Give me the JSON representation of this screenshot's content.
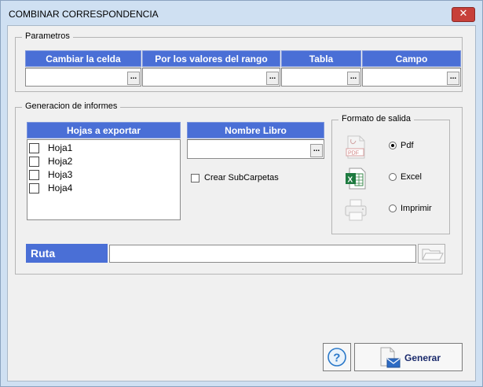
{
  "window": {
    "title": "COMBINAR CORRESPONDENCIA",
    "close_glyph": "✕"
  },
  "parametros": {
    "legend": "Parametros",
    "columns": [
      {
        "header": "Cambiar la celda",
        "value": ""
      },
      {
        "header": "Por los valores del rango",
        "value": ""
      },
      {
        "header": "Tabla",
        "value": ""
      },
      {
        "header": "Campo",
        "value": ""
      }
    ],
    "dots_label": "..."
  },
  "generacion": {
    "legend": "Generacion de informes",
    "hojas_header": "Hojas a exportar",
    "hojas": [
      {
        "label": "Hoja1",
        "checked": false
      },
      {
        "label": "Hoja2",
        "checked": false
      },
      {
        "label": "Hoja3",
        "checked": false
      },
      {
        "label": "Hoja4",
        "checked": false
      }
    ],
    "nombre_libro_header": "Nombre Libro",
    "nombre_libro_value": "",
    "crear_subcarpetas_label": "Crear SubCarpetas",
    "crear_subcarpetas_checked": false,
    "formato": {
      "legend": "Formato de salida",
      "options": [
        {
          "label": "Pdf",
          "icon": "pdf-icon",
          "selected": true
        },
        {
          "label": "Excel",
          "icon": "excel-icon",
          "selected": false
        },
        {
          "label": "Imprimir",
          "icon": "printer-icon",
          "selected": false
        }
      ]
    },
    "ruta_label": "Ruta",
    "ruta_value": ""
  },
  "footer": {
    "help_icon": "help-icon",
    "generar_label": "Generar",
    "generar_icon": "document-mail-icon"
  },
  "colors": {
    "header_blue": "#4a6fd6",
    "window_frame": "#cfe0f2",
    "close_red": "#c7403a"
  }
}
